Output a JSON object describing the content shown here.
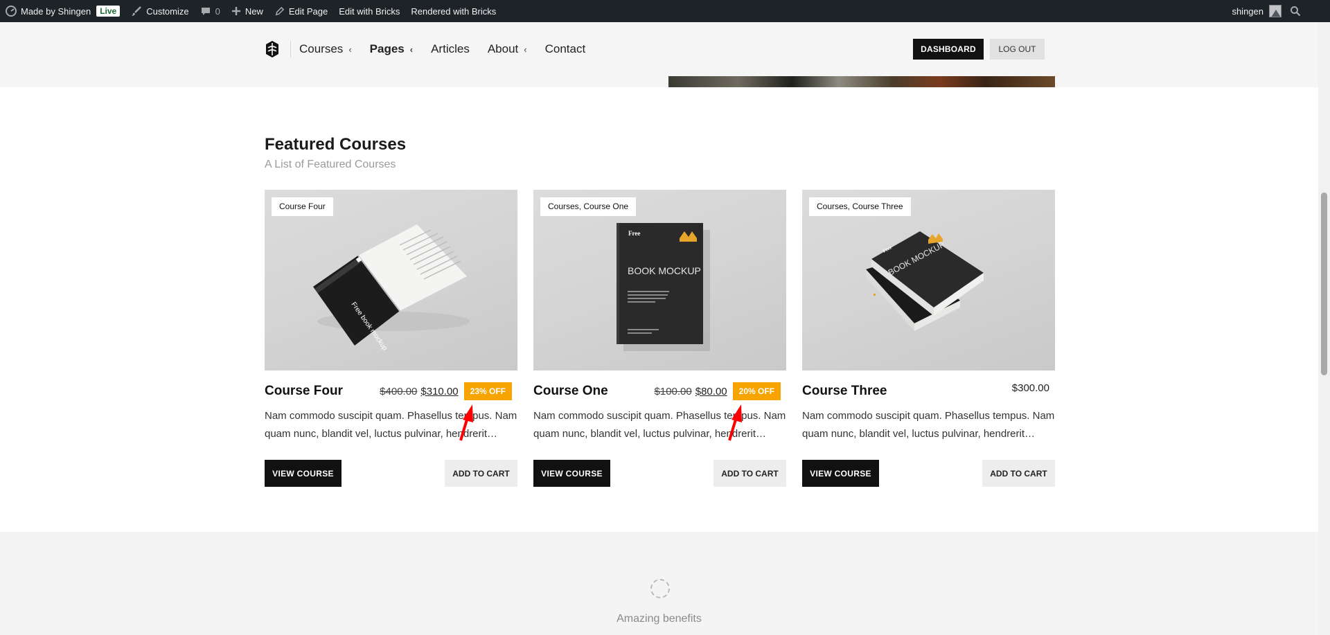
{
  "adminbar": {
    "site_name": "Made by Shingen",
    "live_badge": "Live",
    "customize": "Customize",
    "comments_count": "0",
    "new": "New",
    "edit_page": "Edit Page",
    "edit_with_bricks": "Edit with Bricks",
    "rendered_with_bricks": "Rendered with Bricks",
    "user": "shingen"
  },
  "nav": {
    "items": [
      {
        "label": "Courses",
        "has_dropdown": true
      },
      {
        "label": "Pages",
        "has_dropdown": true
      },
      {
        "label": "Articles",
        "has_dropdown": false
      },
      {
        "label": "About",
        "has_dropdown": true
      },
      {
        "label": "Contact",
        "has_dropdown": false
      }
    ],
    "chevron": "‹",
    "dashboard": "DASHBOARD",
    "logout": "LOG OUT"
  },
  "section": {
    "title": "Featured Courses",
    "subtitle": "A List of Featured Courses"
  },
  "cards": [
    {
      "tag": "Course Four",
      "title": "Course Four",
      "old_price": "$400.00",
      "price": "$310.00",
      "discount": "23% OFF",
      "desc": "Nam commodo suscipit quam. Phasellus tempus. Nam quam nunc, blandit vel, luctus pulvinar, hendrerit…",
      "view": "VIEW COURSE",
      "cart": "ADD TO CART",
      "image": "open-book-mockup",
      "book_text": "Free book mockup"
    },
    {
      "tag": "Courses, Course One",
      "title": "Course One",
      "old_price": "$100.00",
      "price": "$80.00",
      "discount": "20% OFF",
      "desc": "Nam commodo suscipit quam. Phasellus tempus. Nam quam nunc, blandit vel, luctus pulvinar, hendrerit…",
      "view": "VIEW COURSE",
      "cart": "ADD TO CART",
      "image": "standing-book-mockup",
      "book_text": "BOOK MOCKUP",
      "book_label": "Free"
    },
    {
      "tag": "Courses, Course Three",
      "title": "Course Three",
      "price": "$300.00",
      "desc": "Nam commodo suscipit quam. Phasellus tempus. Nam quam nunc, blandit vel, luctus pulvinar, hendrerit…",
      "view": "VIEW COURSE",
      "cart": "ADD TO CART",
      "image": "stacked-books-mockup",
      "book_text": "BOOK MOCKUP",
      "book_label": "Free"
    }
  ],
  "benefits": {
    "label": "Amazing benefits",
    "icon": "dashed-circle-icon"
  },
  "colors": {
    "adminbar": "#1d2327",
    "discount": "#f7a300",
    "primary_button": "#111111",
    "annotation_arrow": "#ff0000"
  }
}
